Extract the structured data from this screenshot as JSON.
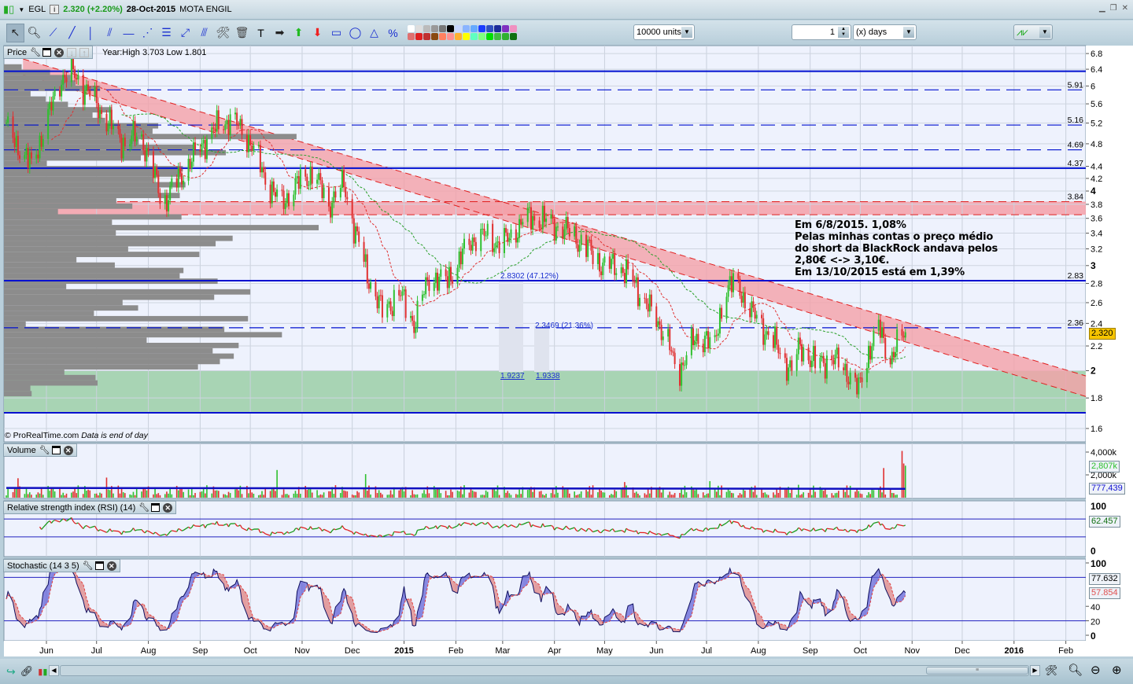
{
  "window": {
    "symbol": "EGL",
    "price_change": "2.320 (+2.20%)",
    "date": "28-Oct-2015",
    "name": "MOTA ENGIL"
  },
  "toolbar": {
    "tools": [
      "pointer-icon",
      "zoom-icon",
      "segment-icon",
      "line-icon",
      "vertical-line-icon",
      "channel-icon",
      "horizontal-line-icon",
      "fan-icon",
      "fibonacci-icon",
      "arrow-line-icon",
      "parallel-icon",
      "tools-icon",
      "trash-icon",
      "text-icon",
      "right-arrow-icon",
      "up-arrow-icon",
      "down-arrow-icon",
      "rectangle-icon",
      "ellipse-icon",
      "triangle-icon",
      "percent-icon"
    ],
    "palette": [
      "#ffffff",
      "#dddddd",
      "#bbbbbb",
      "#999999",
      "#777777",
      "#000000",
      "#c8d8ff",
      "#8ab4ff",
      "#66aaff",
      "#1a3cff",
      "#3050c0",
      "#1c2b9a",
      "#8030c0",
      "#f090c0",
      "#e07070",
      "#e02020",
      "#c03030",
      "#8a4a10",
      "#ff8060",
      "#ff9090",
      "#ffb030",
      "#ffff00",
      "#60ffc0",
      "#80ff80",
      "#00e000",
      "#40c040",
      "#30b030",
      "#107010"
    ],
    "units": "10000 units",
    "period_value": "1",
    "period_unit": "(x) days"
  },
  "price_pane": {
    "label": "Price",
    "year_info": "Year:High 3.703 Low 1.801",
    "copyright": "© ProRealTime.com",
    "data_note": "Data is end of day",
    "current_price": "2.320"
  },
  "annotation": {
    "lines": [
      "Em 6/8/2015. 1,08%",
      "Pelas minhas contas o preço médio",
      "do short da BlackRock andava pelos",
      "2,80€ <-> 3,10€.",
      "Em 13/10/2015 está em 1,39%"
    ]
  },
  "fibonacci": {
    "upper": "2.8302 (47.12%)",
    "middle": "2.3469 (21.36%)",
    "low1": "1.9237",
    "low2": "1.9338"
  },
  "volume_pane": {
    "label": "Volume",
    "ticks": [
      "4,000k",
      "2,000k"
    ],
    "current": "2,807k",
    "average": "777,439"
  },
  "rsi_pane": {
    "label": "Relative strength index (RSI) (14)",
    "ticks": [
      "100",
      "0"
    ],
    "value": "62.457"
  },
  "stoch_pane": {
    "label": "Stochastic (14 3 5)",
    "ticks": [
      "100",
      "40",
      "20",
      "0"
    ],
    "k_value": "77.632",
    "d_value": "57.854"
  },
  "colors": {
    "up": "#2fc02f",
    "down": "#e03030",
    "level": "#0010d0",
    "band": "#f4a0a8",
    "support_zone": "#a8d4b4",
    "price_tag": "#f6c400"
  },
  "chart_data": {
    "type": "candlestick",
    "title": "EGL MOTA ENGIL",
    "y_scale": "log",
    "ylim": [
      1.6,
      6.8
    ],
    "y_ticks": [
      "6.8",
      "6.4",
      "6",
      "5.6",
      "5.2",
      "4.8",
      "4.4",
      "4.2",
      "4",
      "3.8",
      "3.6",
      "3.4",
      "3.2",
      "3",
      "2.8",
      "2.6",
      "2.4",
      "2.2",
      "2",
      "1.8",
      "1.6"
    ],
    "x_ticks": [
      [
        "Jun",
        "2014-06-01"
      ],
      [
        "Jul",
        "2014-07-01"
      ],
      [
        "Aug",
        "2014-08-01"
      ],
      [
        "Sep",
        "2014-09-01"
      ],
      [
        "Oct",
        "2014-10-01"
      ],
      [
        "Nov",
        "2014-11-01"
      ],
      [
        "Dec",
        "2014-12-01"
      ],
      [
        "2015",
        "2015-01-01"
      ],
      [
        "Feb",
        "2015-02-01"
      ],
      [
        "Mar",
        "2015-03-01"
      ],
      [
        "Apr",
        "2015-04-01"
      ],
      [
        "May",
        "2015-05-01"
      ],
      [
        "Jun",
        "2015-06-01"
      ],
      [
        "Jul",
        "2015-07-01"
      ],
      [
        "Aug",
        "2015-08-01"
      ],
      [
        "Sep",
        "2015-09-01"
      ],
      [
        "Oct",
        "2015-10-01"
      ],
      [
        "Nov",
        "2015-11-01"
      ],
      [
        "Dec",
        "2015-12-01"
      ],
      [
        "2016",
        "2016-01-01"
      ],
      [
        "Feb",
        "2016-02-01"
      ]
    ],
    "close": [
      [
        "2014-05-08",
        5.1
      ],
      [
        "2014-05-23",
        4.4
      ],
      [
        "2014-06-01",
        5.2
      ],
      [
        "2014-06-10",
        6.2
      ],
      [
        "2014-06-17",
        6.3
      ],
      [
        "2014-06-29",
        5.7
      ],
      [
        "2014-07-08",
        5.2
      ],
      [
        "2014-07-18",
        4.8
      ],
      [
        "2014-07-27",
        5.0
      ],
      [
        "2014-08-05",
        4.2
      ],
      [
        "2014-08-10",
        3.8
      ],
      [
        "2014-08-19",
        4.2
      ],
      [
        "2014-08-29",
        4.6
      ],
      [
        "2014-09-07",
        5.0
      ],
      [
        "2014-09-19",
        5.3
      ],
      [
        "2014-09-30",
        4.9
      ],
      [
        "2014-10-10",
        4.2
      ],
      [
        "2014-10-19",
        3.8
      ],
      [
        "2014-10-29",
        4.1
      ],
      [
        "2014-11-07",
        4.3
      ],
      [
        "2014-11-17",
        3.8
      ],
      [
        "2014-11-26",
        4.1
      ],
      [
        "2014-12-03",
        3.4
      ],
      [
        "2014-12-10",
        2.9
      ],
      [
        "2014-12-19",
        2.5
      ],
      [
        "2014-12-29",
        2.7
      ],
      [
        "2015-01-07",
        2.4
      ],
      [
        "2015-01-17",
        2.9
      ],
      [
        "2015-01-26",
        2.8
      ],
      [
        "2015-02-04",
        3.1
      ],
      [
        "2015-02-14",
        3.4
      ],
      [
        "2015-02-23",
        3.3
      ],
      [
        "2015-03-04",
        3.3
      ],
      [
        "2015-03-14",
        3.6
      ],
      [
        "2015-03-23",
        3.6
      ],
      [
        "2015-04-02",
        3.5
      ],
      [
        "2015-04-11",
        3.4
      ],
      [
        "2015-04-21",
        3.2
      ],
      [
        "2015-04-30",
        3.0
      ],
      [
        "2015-05-10",
        3.0
      ],
      [
        "2015-05-19",
        2.8
      ],
      [
        "2015-05-29",
        2.5
      ],
      [
        "2015-06-07",
        2.3
      ],
      [
        "2015-06-13",
        1.95
      ],
      [
        "2015-06-21",
        2.2
      ],
      [
        "2015-07-01",
        2.3
      ],
      [
        "2015-07-05",
        2.1
      ],
      [
        "2015-07-12",
        2.75
      ],
      [
        "2015-07-19",
        2.8
      ],
      [
        "2015-07-28",
        2.5
      ],
      [
        "2015-08-07",
        2.3
      ],
      [
        "2015-08-16",
        2.1
      ],
      [
        "2015-08-21",
        2.0
      ],
      [
        "2015-08-26",
        2.2
      ],
      [
        "2015-09-04",
        2.05
      ],
      [
        "2015-09-14",
        2.1
      ],
      [
        "2015-09-23",
        2.0
      ],
      [
        "2015-09-30",
        1.85
      ],
      [
        "2015-10-07",
        2.2
      ],
      [
        "2015-10-12",
        2.35
      ],
      [
        "2015-10-19",
        2.1
      ],
      [
        "2015-10-28",
        2.32
      ]
    ],
    "levels": [
      {
        "value": 6.35,
        "style": "solid",
        "label": ""
      },
      {
        "value": 5.91,
        "style": "dashed",
        "label": "5.91"
      },
      {
        "value": 5.16,
        "style": "dashed",
        "label": "5.16"
      },
      {
        "value": 4.69,
        "style": "dashed",
        "label": "4.69"
      },
      {
        "value": 4.37,
        "style": "solid",
        "label": "4.37"
      },
      {
        "value": 2.83,
        "style": "solid",
        "label": "2.83"
      },
      {
        "value": 2.36,
        "style": "dashed",
        "label": "2.36"
      },
      {
        "value": 1.7,
        "style": "solid",
        "label": ""
      }
    ],
    "resistance_band": {
      "low": 3.65,
      "high": 3.84,
      "label": "3.84"
    },
    "support_zone": {
      "low": 1.7,
      "high": 2.0
    },
    "trend_channel": {
      "start": "2014-05-18",
      "end": "2016-02-13",
      "upper": [
        6.66,
        1.96
      ],
      "lower": [
        6.27,
        1.81
      ]
    },
    "volume_ylim": [
      0,
      4500
    ],
    "rsi_levels": [
      70,
      30
    ],
    "stoch_levels": [
      80,
      20
    ]
  }
}
